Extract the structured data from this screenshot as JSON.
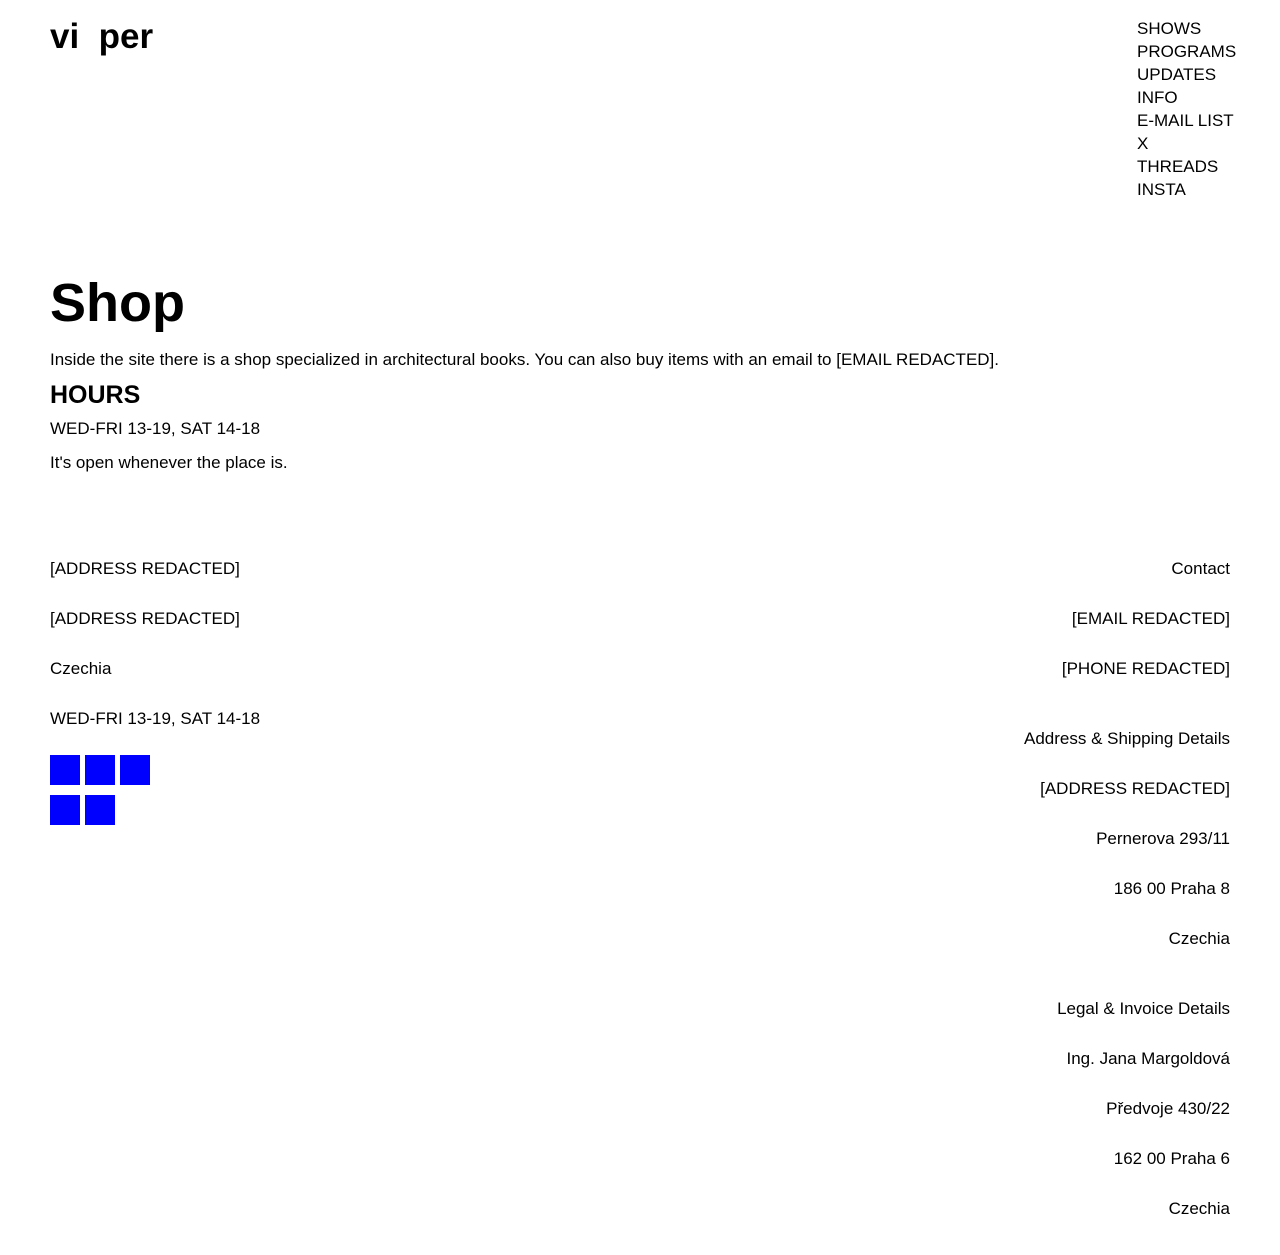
{
  "header": {
    "logo_text": "vi  per",
    "nav": [
      "SHOWS",
      "PROGRAMS",
      "UPDATES",
      "INFO",
      "E-MAIL LIST",
      "X",
      "THREADS",
      "INSTA"
    ]
  },
  "main": {
    "title": "Shop",
    "intro": "Inside the site there is a shop specialized in architectural books. You can also buy items with an email to [EMAIL REDACTED].",
    "hours_heading": "HOURS",
    "hours": "WED-FRI 13-19, SAT 14-18",
    "note": "It's open whenever the place is."
  },
  "footer": {
    "left": {
      "address1": "[ADDRESS REDACTED]",
      "address2": "[ADDRESS REDACTED]",
      "country": "Czechia",
      "hours": "WED-FRI 13-19, SAT 14-18",
      "social_color": "#0000ff",
      "social_count": 5
    },
    "right": {
      "contact": {
        "heading": "Contact",
        "email": "[EMAIL REDACTED]",
        "phone": "[PHONE REDACTED]"
      },
      "shipping": {
        "heading": "Address & Shipping Details",
        "line1": "[ADDRESS REDACTED]",
        "line2": "Pernerova 293/11",
        "line3": "186 00 Praha 8",
        "line4": "Czechia"
      },
      "legal": {
        "heading": "Legal & Invoice Details",
        "line1": "Ing. Jana Margoldová",
        "line2": "Předvoje 430/22",
        "line3": "162 00 Praha 6",
        "line4": "Czechia"
      }
    }
  }
}
